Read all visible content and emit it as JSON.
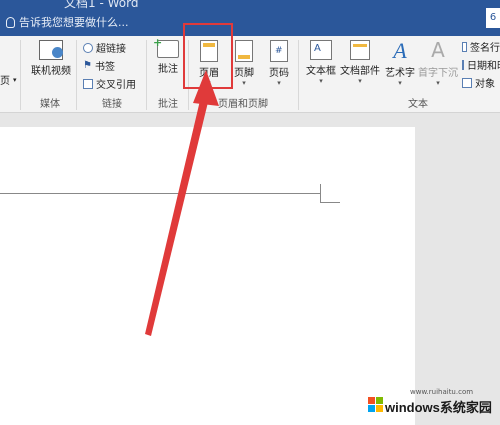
{
  "titlebar": {
    "title": "文档1 - Word",
    "tell_me": "告诉我您想要做什么...",
    "share_icon": "share-icon"
  },
  "ribbon": {
    "groups": {
      "media": "媒体",
      "links": "链接",
      "comments": "批注",
      "header_footer": "页眉和页脚",
      "text": "文本"
    },
    "left_cut": "页",
    "online_video": "联机视频",
    "hyperlink": "超链接",
    "bookmark": "书签",
    "cross_ref": "交叉引用",
    "comment": "批注",
    "header": "页眉",
    "footer": "页脚",
    "page_number": "页码",
    "text_box": "文本框",
    "quick_parts": "文档部件",
    "wordart": "艺术字",
    "drop_cap": "首字下沉",
    "signature_line": "签名行",
    "date_time": "日期和时间",
    "object": "对象"
  },
  "watermark": {
    "title": "windows系统家园",
    "url": "www.ruihaitu.com"
  },
  "annotation": {
    "highlight_color": "#e03a3a"
  }
}
